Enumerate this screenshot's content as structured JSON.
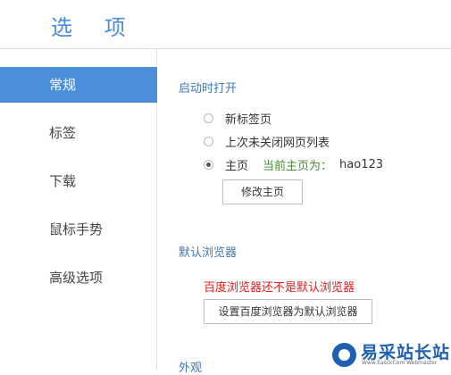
{
  "header": {
    "title": "选 项"
  },
  "sidebar": {
    "items": [
      {
        "label": "常规",
        "active": true
      },
      {
        "label": "标签",
        "active": false
      },
      {
        "label": "下载",
        "active": false
      },
      {
        "label": "鼠标手势",
        "active": false
      },
      {
        "label": "高级选项",
        "active": false
      }
    ]
  },
  "startup": {
    "title": "启动时打开",
    "options": [
      {
        "label": "新标签页",
        "selected": false
      },
      {
        "label": "上次未关闭网页列表",
        "selected": false
      },
      {
        "label": "主页",
        "selected": true
      }
    ],
    "current_home_label": "当前主页为：",
    "current_home_value": "hao123",
    "modify_button": "修改主页"
  },
  "default_browser": {
    "title": "默认浏览器",
    "warning": "百度浏览器还不是默认浏览器",
    "set_button": "设置百度浏览器为默认浏览器"
  },
  "appearance": {
    "title": "外观"
  },
  "watermark": {
    "brand": "易采站长站",
    "subtitle": "Www.EasckCom Webmaster"
  },
  "colors": {
    "accent": "#4a8fd9",
    "section_title": "#3f78b4",
    "warning": "#e02020",
    "current_home": "#4b8c2e"
  }
}
